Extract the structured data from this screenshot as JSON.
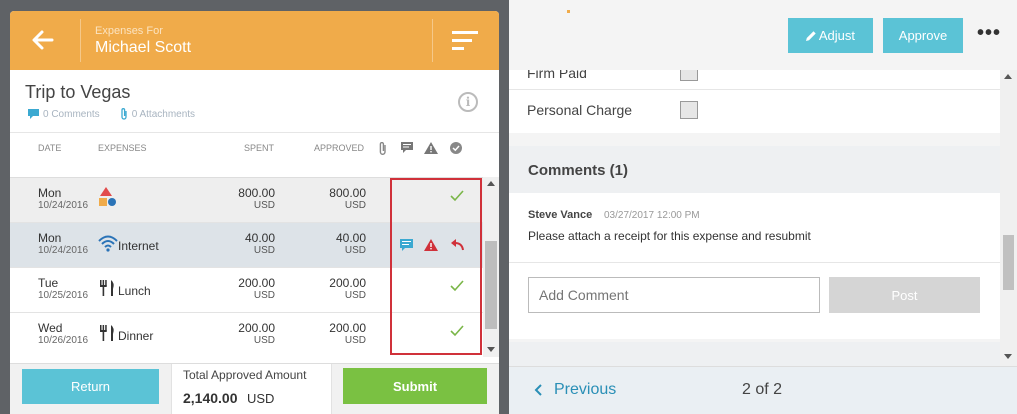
{
  "header": {
    "subtitle": "Expenses For",
    "employee_name": "Michael Scott"
  },
  "report": {
    "title": "Trip to Vegas",
    "comments_count": "0 Comments",
    "attachments_count": "0 Attachments"
  },
  "columns": {
    "date": "DATE",
    "expenses": "EXPENSES",
    "spent": "SPENT",
    "approved": "APPROVED"
  },
  "rows": [
    {
      "day": "Mon",
      "date": "10/24/2016",
      "label": "",
      "icon": "shapes-category-icon",
      "spent": "800.00",
      "approved": "800.00",
      "currency": "USD",
      "status": "approved"
    },
    {
      "day": "Mon",
      "date": "10/24/2016",
      "label": "Internet",
      "icon": "wifi-icon",
      "spent": "40.00",
      "approved": "40.00",
      "currency": "USD",
      "status": "returned"
    },
    {
      "day": "Tue",
      "date": "10/25/2016",
      "label": "Lunch",
      "icon": "fork-knife-icon",
      "spent": "200.00",
      "approved": "200.00",
      "currency": "USD",
      "status": "approved"
    },
    {
      "day": "Wed",
      "date": "10/26/2016",
      "label": "Dinner",
      "icon": "fork-knife-icon",
      "spent": "200.00",
      "approved": "200.00",
      "currency": "USD",
      "status": "approved"
    }
  ],
  "footer": {
    "return_label": "Return",
    "total_label": "Total Approved Amount",
    "total_value": "2,140.00",
    "total_currency": "USD",
    "submit_label": "Submit"
  },
  "detail": {
    "adjust_label": "Adjust",
    "approve_label": "Approve",
    "more_label": "•••",
    "firm_paid_label": "Firm Paid",
    "personal_charge_label": "Personal Charge",
    "comments_title": "Comments  (1)",
    "comment": {
      "author": "Steve Vance",
      "date": "03/27/2017 12:00 PM",
      "text": "Please attach a receipt for this expense and resubmit"
    },
    "add_comment_placeholder": "Add Comment",
    "post_label": "Post",
    "previous_label": "Previous",
    "pager": "2 of 2"
  },
  "colors": {
    "header_orange": "#f0ab4a",
    "teal_button": "#5bc3d6",
    "green_submit": "#7ac142",
    "approved_check": "#7ab648",
    "warning_red": "#d0313a",
    "comment_blue": "#3ba9d1"
  }
}
